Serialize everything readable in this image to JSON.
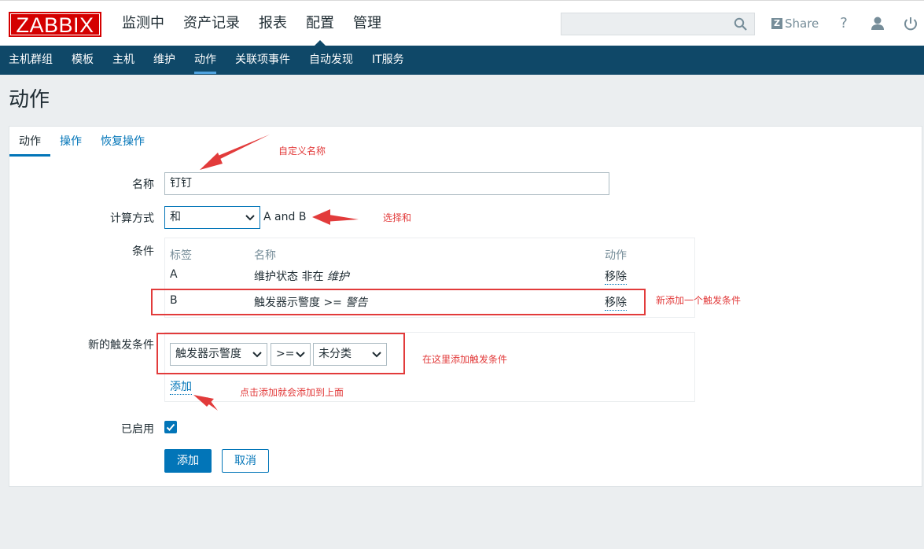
{
  "header": {
    "logo": "ZABBIX",
    "menu": [
      "监测中",
      "资产记录",
      "报表",
      "配置",
      "管理"
    ],
    "active_menu": "配置",
    "search_placeholder": "",
    "share": "Share",
    "help": "?"
  },
  "subnav": [
    "主机群组",
    "模板",
    "主机",
    "维护",
    "动作",
    "关联项事件",
    "自动发现",
    "IT服务"
  ],
  "page_title": "动作",
  "tabs": [
    "动作",
    "操作",
    "恢复操作"
  ],
  "form": {
    "name_label": "名称",
    "name_value": "钉钉",
    "calc_label": "计算方式",
    "calc_value": "和",
    "calc_expr": "A and B",
    "conditions_label": "条件",
    "conditions": {
      "headers": [
        "标签",
        "名称",
        "动作"
      ],
      "rows": [
        {
          "tag": "A",
          "name": "维护状态 非在 ",
          "name_em": "维护",
          "action": "移除"
        },
        {
          "tag": "B",
          "name": "触发器示警度 >= ",
          "name_em": "警告",
          "action": "移除"
        }
      ]
    },
    "new_condition_label": "新的触发条件",
    "new_condition": {
      "type": "触发器示警度",
      "operator": ">=",
      "value": "未分类",
      "add_link": "添加"
    },
    "enabled_label": "已启用",
    "enabled": true,
    "add_button": "添加",
    "cancel_button": "取消"
  },
  "annotations": {
    "custom_name": "自定义名称",
    "choose_and": "选择和",
    "new_trigger_added": "新添加一个触发条件",
    "add_here": "在这里添加触发条件",
    "click_add": "点击添加就会添加到上面"
  },
  "colors": {
    "brand_red": "#d40000",
    "nav_bg": "#0f4868",
    "link_blue": "#0275b8",
    "annotation_red": "#e23b3b"
  }
}
